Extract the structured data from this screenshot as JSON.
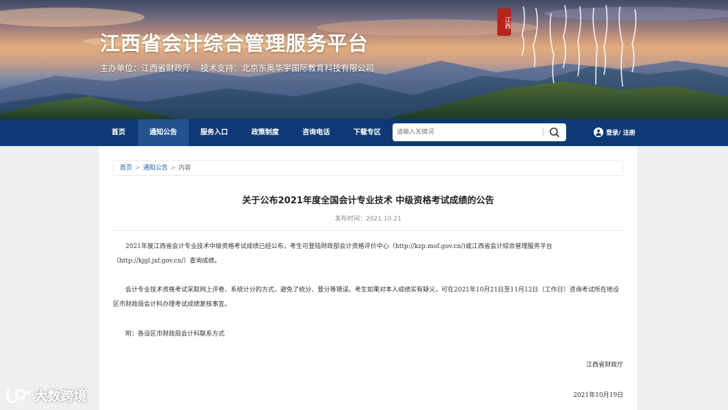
{
  "header": {
    "site_title": "江西省会计综合管理服务平台",
    "sponsor": "主办单位：江西省财政厅",
    "tech_support": "技术支持：北京东奥华宇国际教育科技有限公司"
  },
  "nav": {
    "items": [
      {
        "label": "首页"
      },
      {
        "label": "通知公告"
      },
      {
        "label": "服务入口"
      },
      {
        "label": "政策制度"
      },
      {
        "label": "咨询电话"
      },
      {
        "label": "下载专区"
      }
    ],
    "active_index": 1,
    "search_placeholder": "请输入关键词",
    "login_label": "登录/ 注册"
  },
  "breadcrumb": {
    "home": "首页",
    "section": "通知公告",
    "current": "内容",
    "separator": ">"
  },
  "article": {
    "title": "关于公布2021年度全国会计专业技术 中级资格考试成绩的公告",
    "publish_date": "发布时间：2021.10.21",
    "paragraphs": [
      "2021年度江西省会计专业技术中级资格考试成绩已经公布，考生可登陆财政部会计资格评价中心（http://kzp.mof.gov.cn/)或江西省会计综合管理服务平台（http://kjgl.jxf.gov.cn/）查询成绩。",
      "会计专业技术资格考试采取网上评卷、系统计分的方式，避免了统分、登分等错误。考生如果对本人成绩实有疑义，可在2021年10月21日至11月12日（工作日）咨询考试所在地设区市财政局会计科办理考试成绩复核事宜。",
      "附：各设区市财政局会计科联系方式"
    ],
    "signature": "江西省财政厅",
    "signature_date": "2021年10月19日"
  },
  "watermark": {
    "text": "大数跨境"
  },
  "colors": {
    "nav_bg": "#0d3a74",
    "nav_active": "#23528f",
    "link": "#1f5fa6",
    "seal": "#b8231c"
  }
}
